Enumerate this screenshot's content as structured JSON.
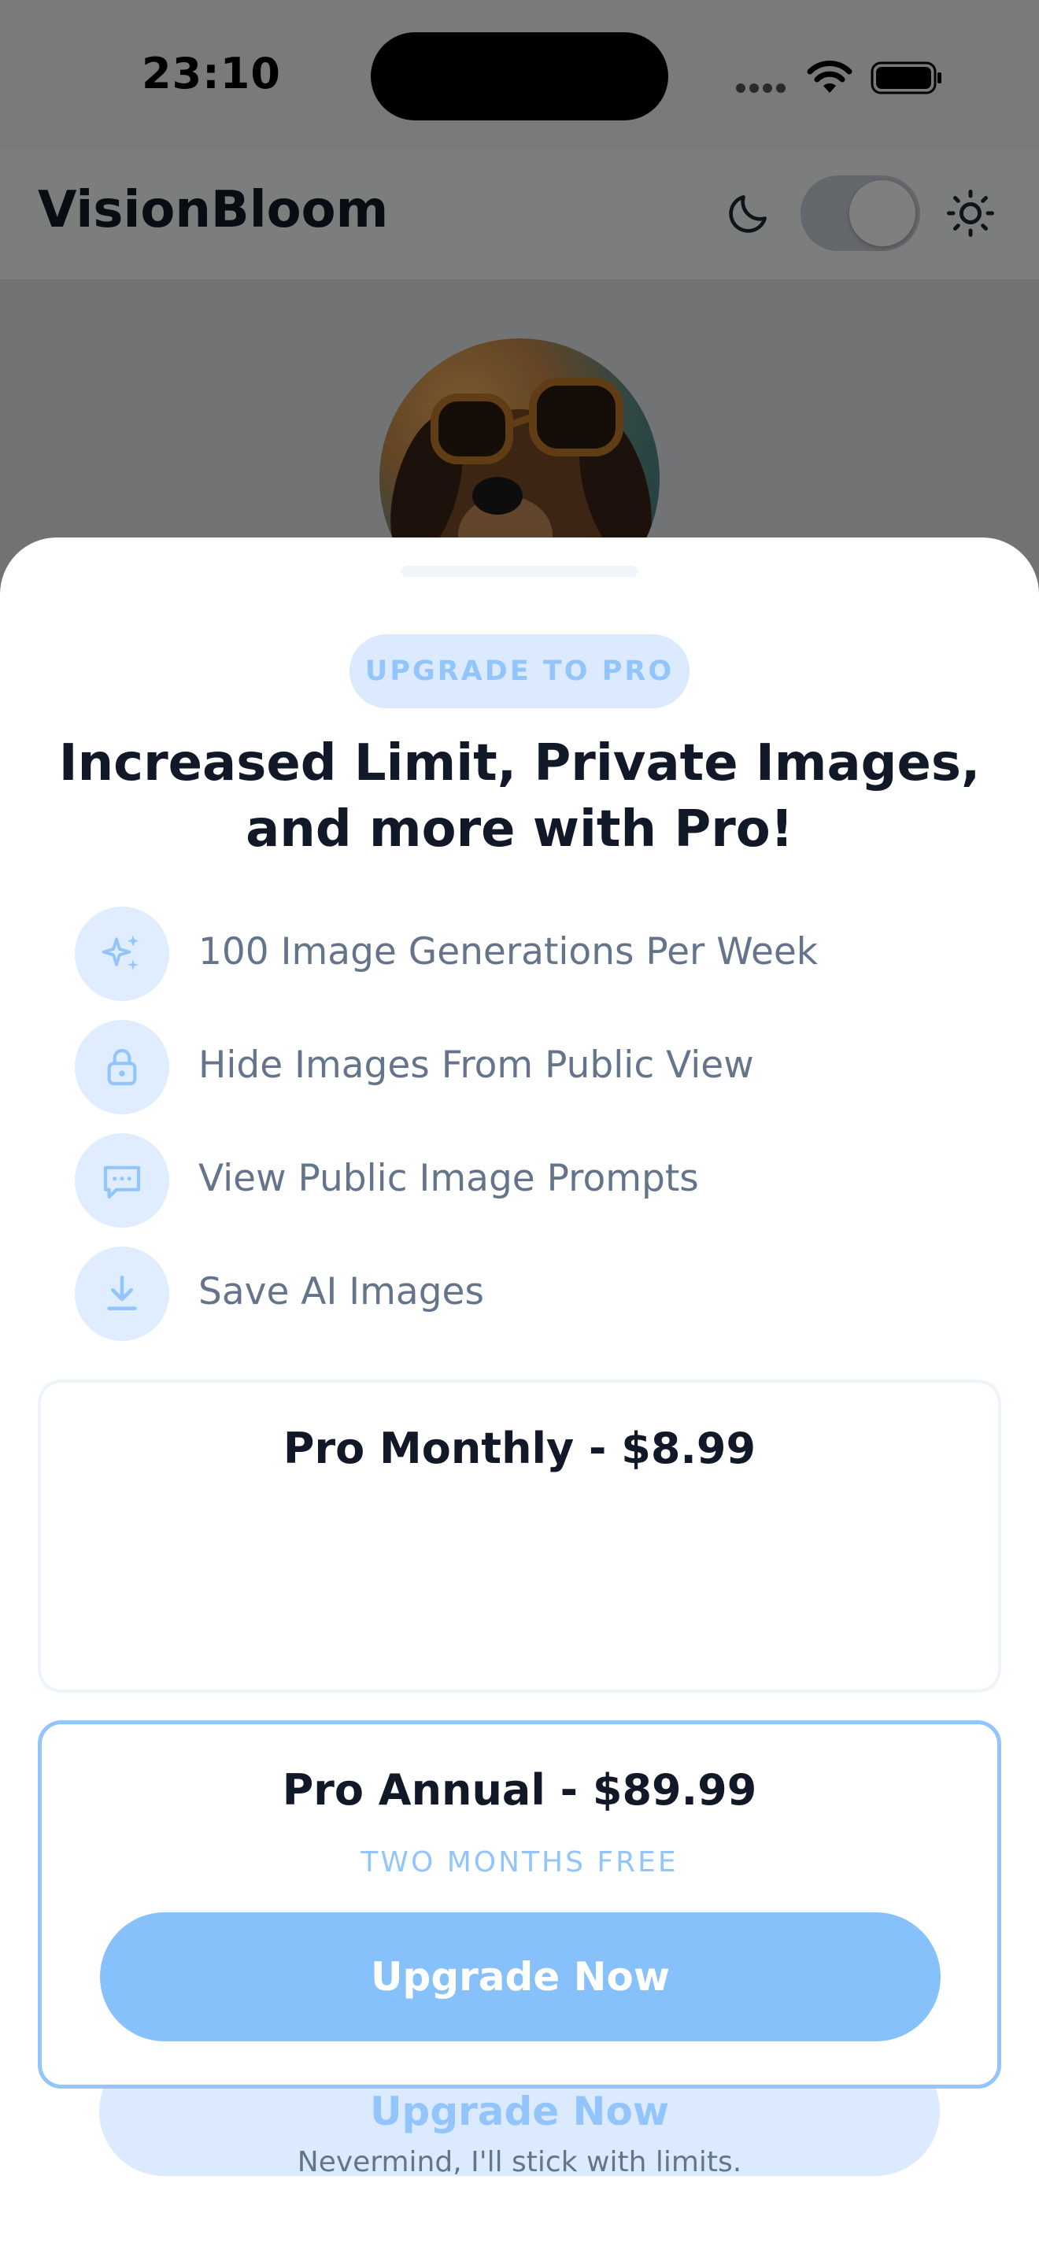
{
  "status_bar": {
    "time": "23:10"
  },
  "header": {
    "app_title": "VisionBloom",
    "theme_toggle_state": "light"
  },
  "icons": {
    "status": [
      "signal-dots-icon",
      "wifi-icon",
      "battery-icon"
    ],
    "header": [
      "moon-icon",
      "sun-icon"
    ],
    "features": [
      "sparkles-icon",
      "lock-icon",
      "chat-icon",
      "download-icon"
    ]
  },
  "colors": {
    "accent": "#93c5fd",
    "accent_light": "#dbeafe",
    "primary_button": "#87c1fb",
    "title_text": "#111827",
    "body_text": "#64748b"
  },
  "sheet": {
    "badge": "UPGRADE TO PRO",
    "title": "Increased Limit, Private Images, and more with Pro!",
    "features": [
      {
        "icon": "sparkles-icon",
        "label": "100 Image Generations Per Week"
      },
      {
        "icon": "lock-icon",
        "label": "Hide Images From Public View"
      },
      {
        "icon": "chat-icon",
        "label": "View Public Image Prompts"
      },
      {
        "icon": "download-icon",
        "label": "Save AI Images"
      }
    ],
    "plans": [
      {
        "title": "Pro Monthly - $8.99",
        "subtitle": "",
        "button": "Upgrade Now"
      },
      {
        "title": "Pro Annual - $89.99",
        "subtitle": "TWO MONTHS FREE",
        "button": "Upgrade Now"
      }
    ],
    "dismiss": "Nevermind, I'll stick with limits."
  }
}
